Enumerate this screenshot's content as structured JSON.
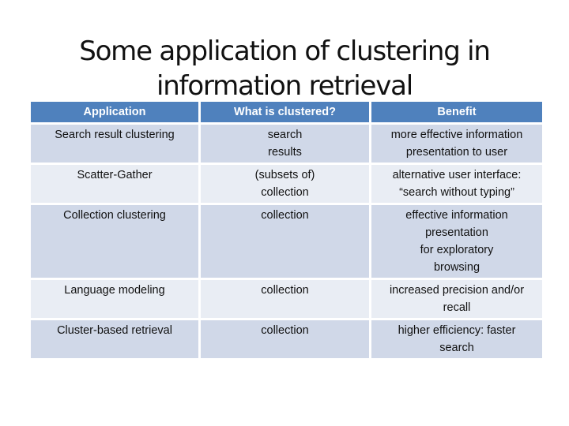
{
  "title": {
    "line1": "Some application of clustering in",
    "line2": "information retrieval"
  },
  "table": {
    "headers": [
      "Application",
      "What is clustered?",
      "Benefit"
    ],
    "rows": [
      {
        "application": [
          "Search result clustering"
        ],
        "clustered": [
          "search",
          "results"
        ],
        "benefit": [
          "more effective information",
          "presentation to user"
        ]
      },
      {
        "application": [
          "Scatter-Gather"
        ],
        "clustered": [
          "(subsets of)",
          "collection"
        ],
        "benefit": [
          "alternative user interface:",
          "“search without typing”"
        ]
      },
      {
        "application": [
          "Collection clustering"
        ],
        "clustered": [
          "collection"
        ],
        "benefit": [
          "effective information",
          "presentation",
          "for exploratory",
          "browsing"
        ]
      },
      {
        "application": [
          "Language modeling"
        ],
        "clustered": [
          "collection"
        ],
        "benefit": [
          "increased precision and/or",
          "recall"
        ]
      },
      {
        "application": [
          "Cluster-based retrieval"
        ],
        "clustered": [
          "collection"
        ],
        "benefit": [
          "higher efficiency: faster",
          "search"
        ]
      }
    ]
  },
  "colors": {
    "header_bg": "#4f81bd",
    "row_odd_bg": "#d0d8e8",
    "row_even_bg": "#e9edf4"
  }
}
